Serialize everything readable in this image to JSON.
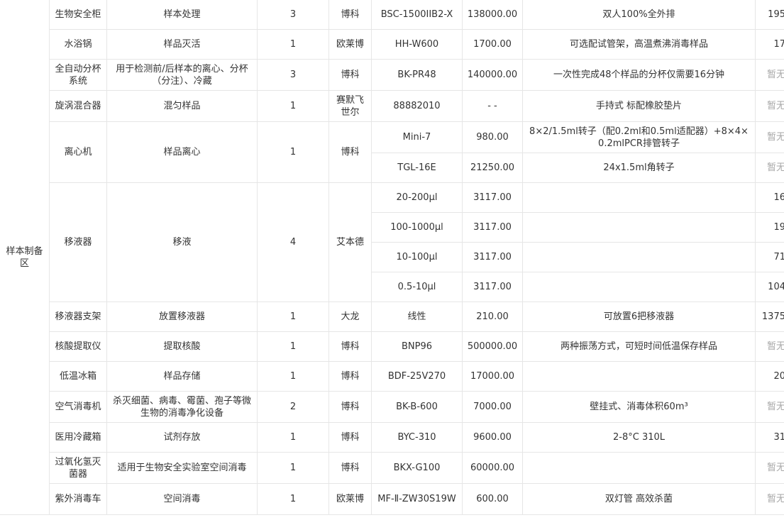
{
  "area_label": "样本制备区",
  "rows": [
    {
      "name": "生物安全柜",
      "use": "样本处理",
      "qty": "3",
      "brand": "博科",
      "model": "BSC-1500IIB2-X",
      "price": "138000.00",
      "note": "双人100%全外排",
      "last": "195"
    },
    {
      "name": "水浴锅",
      "use": "样品灭活",
      "qty": "1",
      "brand": "欧莱博",
      "model": "HH-W600",
      "price": "1700.00",
      "note": "可选配试管架，高温煮沸消毒样品",
      "last": "17"
    },
    {
      "name": "全自动分杯系统",
      "use": "用于检测前/后样本的离心、分杯（分注）、冷藏",
      "qty": "3",
      "brand": "博科",
      "model": "BK-PR48",
      "price": "140000.00",
      "note": "一次性完成48个样品的分杯仅需要16分钟",
      "last": "暂无"
    },
    {
      "name": "旋涡混合器",
      "use": "混匀样品",
      "qty": "1",
      "brand": "赛默飞世尔",
      "model": "88882010",
      "price": "- -",
      "note": "手持式 标配橡胶垫片",
      "last": "暂无"
    },
    {
      "name": "离心机",
      "use": "样品离心",
      "qty": "1",
      "brand": "博科",
      "variants": [
        {
          "model": "Mini-7",
          "price": "980.00",
          "note": "8×2/1.5ml转子（配0.2ml和0.5ml适配器）+8×4×0.2mlPCR排管转子",
          "last": "暂无"
        },
        {
          "model": "TGL-16E",
          "price": "21250.00",
          "note": "24x1.5ml角转子",
          "last": "暂无"
        }
      ]
    },
    {
      "name": "移液器",
      "use": "移液",
      "qty": "4",
      "brand": "艾本德",
      "variants": [
        {
          "model": "20-200μl",
          "price": "3117.00",
          "note": "",
          "last": "16"
        },
        {
          "model": "100-1000μl",
          "price": "3117.00",
          "note": "",
          "last": "19"
        },
        {
          "model": "10-100μl",
          "price": "3117.00",
          "note": "",
          "last": "71"
        },
        {
          "model": "0.5-10μl",
          "price": "3117.00",
          "note": "",
          "last": "104"
        }
      ]
    },
    {
      "name": "移液器支架",
      "use": "放置移液器",
      "qty": "1",
      "brand": "大龙",
      "model": "线性",
      "price": "210.00",
      "note": "可放置6把移液器",
      "last": "1375"
    },
    {
      "name": "核酸提取仪",
      "use": "提取核酸",
      "qty": "1",
      "brand": "博科",
      "model": "BNP96",
      "price": "500000.00",
      "note": "两种振荡方式，可短时间低温保存样品",
      "last": "暂无"
    },
    {
      "name": "低温冰箱",
      "use": "样品存储",
      "qty": "1",
      "brand": "博科",
      "model": "BDF-25V270",
      "price": "17000.00",
      "note": "",
      "last": "20"
    },
    {
      "name": "空气消毒机",
      "use": "杀灭细菌、病毒、霉菌、孢子等微生物的消毒净化设备",
      "qty": "2",
      "brand": "博科",
      "model": "BK-B-600",
      "price": "7000.00",
      "note": "壁挂式、消毒体积60m³",
      "last": "暂无"
    },
    {
      "name": "医用冷藏箱",
      "use": "试剂存放",
      "qty": "1",
      "brand": "博科",
      "model": "BYC-310",
      "price": "9600.00",
      "note": "2-8°C 310L",
      "last": "31"
    },
    {
      "name": "过氧化氢灭菌器",
      "use": "适用于生物安全实验室空间消毒",
      "qty": "1",
      "brand": "博科",
      "model": "BKX-G100",
      "price": "60000.00",
      "note": "",
      "last": "暂无"
    },
    {
      "name": "紫外消毒车",
      "use": "空间消毒",
      "qty": "1",
      "brand": "欧莱博",
      "model": "MF-Ⅱ-ZW30S19W",
      "price": "600.00",
      "note": "双灯管 高效杀菌",
      "last": "暂无"
    }
  ]
}
